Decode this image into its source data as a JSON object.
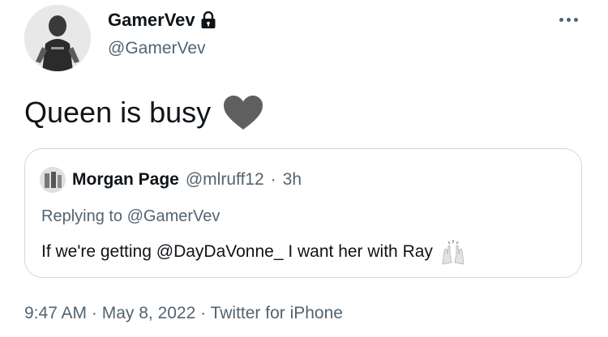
{
  "author": {
    "name": "GamerVev",
    "handle": "@GamerVev",
    "protected_icon": "lock-icon",
    "avatar_icon": "avatar"
  },
  "menu_icon": "more-horizontal-icon",
  "tweet": {
    "text": "Queen is busy",
    "emoji_icon": "heart-icon",
    "emoji_color": "#5f5f5f"
  },
  "quote": {
    "name": "Morgan Page",
    "handle": "@mlruff12",
    "separator": "·",
    "time": "3h",
    "replying_to": "Replying to @GamerVev",
    "text": "If we're getting @DayDaVonne_ I want her with Ray",
    "emoji_icon": "raised-hands-icon"
  },
  "timestamp": "9:47 AM · May 8, 2022 · Twitter for iPhone",
  "colors": {
    "text_primary": "#0f1419",
    "text_secondary": "#536471",
    "border": "#cfd9de"
  }
}
